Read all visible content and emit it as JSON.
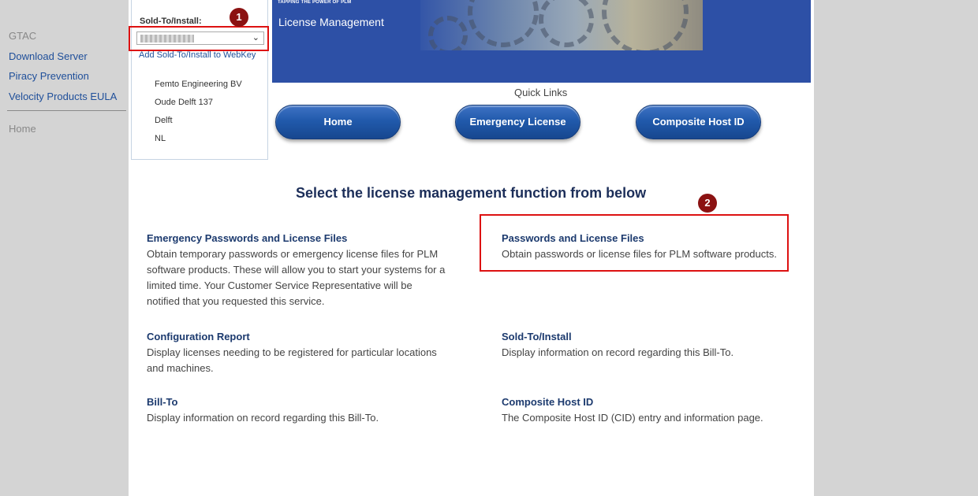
{
  "left_nav": {
    "items": [
      {
        "label": "GTAC",
        "style": "gray"
      },
      {
        "label": "Download Server",
        "style": "link"
      },
      {
        "label": "Piracy Prevention",
        "style": "link"
      },
      {
        "label": "Velocity Products EULA",
        "style": "link"
      }
    ],
    "home": "Home"
  },
  "soldto": {
    "label": "Sold-To/Install:",
    "selected_value": "",
    "add_link": "Add Sold-To/Install to WebKey",
    "address": [
      "Femto Engineering BV",
      "Oude Delft 137",
      "Delft",
      "NL"
    ]
  },
  "annotations": {
    "badge1": "1",
    "badge2": "2",
    "highlight_color": "#dd1111"
  },
  "banner": {
    "tagline": "TAPPING THE POWER OF PLM",
    "title": "License Management"
  },
  "quick_links": {
    "label": "Quick Links",
    "buttons": [
      "Home",
      "Emergency License",
      "Composite Host ID"
    ]
  },
  "headline": "Select the license management function from below",
  "functions": [
    {
      "title": "Emergency Passwords and License Files",
      "desc": "Obtain temporary passwords or emergency license files for PLM software products. These will allow you to start your systems for a limited time. Your Customer Service Representative will be notified that you requested this service."
    },
    {
      "title": "Passwords and License Files",
      "desc": "Obtain passwords or license files for PLM software products."
    },
    {
      "title": "Configuration Report",
      "desc": "Display licenses needing to be registered for particular locations and machines."
    },
    {
      "title": "Sold-To/Install",
      "desc": "Display information on record regarding this Bill-To."
    },
    {
      "title": "Bill-To",
      "desc": "Display information on record regarding this Bill-To."
    },
    {
      "title": "Composite Host ID",
      "desc": "The Composite Host ID (CID) entry and information page."
    }
  ],
  "colors": {
    "banner_bg": "#2d50a6",
    "link": "#1f4f9a",
    "button": "#215aac",
    "heading": "#1c2e59"
  }
}
